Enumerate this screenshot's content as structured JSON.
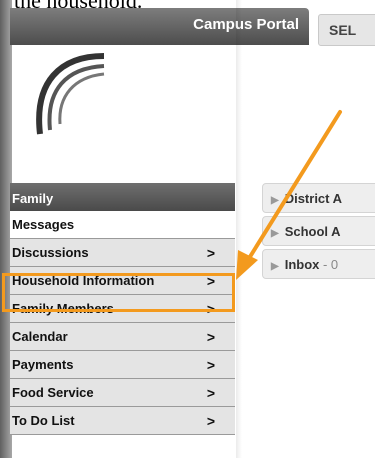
{
  "caption": "the household.",
  "header": {
    "title": "Campus Portal",
    "select_tab": "SEL"
  },
  "nav": {
    "header": "Family",
    "items": [
      {
        "label": "Messages",
        "chevron": ""
      },
      {
        "label": "Discussions",
        "chevron": ">"
      },
      {
        "label": "Household Information",
        "chevron": ">"
      },
      {
        "label": "Family Members",
        "chevron": ">"
      },
      {
        "label": "Calendar",
        "chevron": ">"
      },
      {
        "label": "Payments",
        "chevron": ">"
      },
      {
        "label": "Food Service",
        "chevron": ">"
      },
      {
        "label": "To Do List",
        "chevron": ">"
      }
    ]
  },
  "right_panel": {
    "items": [
      {
        "label": "District A",
        "count": ""
      },
      {
        "label": "School A",
        "count": ""
      },
      {
        "label": "Inbox",
        "count": " - 0"
      }
    ]
  },
  "colors": {
    "highlight": "#f39a1e",
    "header": "#5a5a5a"
  },
  "icons": {
    "arrow": "orange-annotation-arrow",
    "logo": "campus-arc-logo"
  }
}
